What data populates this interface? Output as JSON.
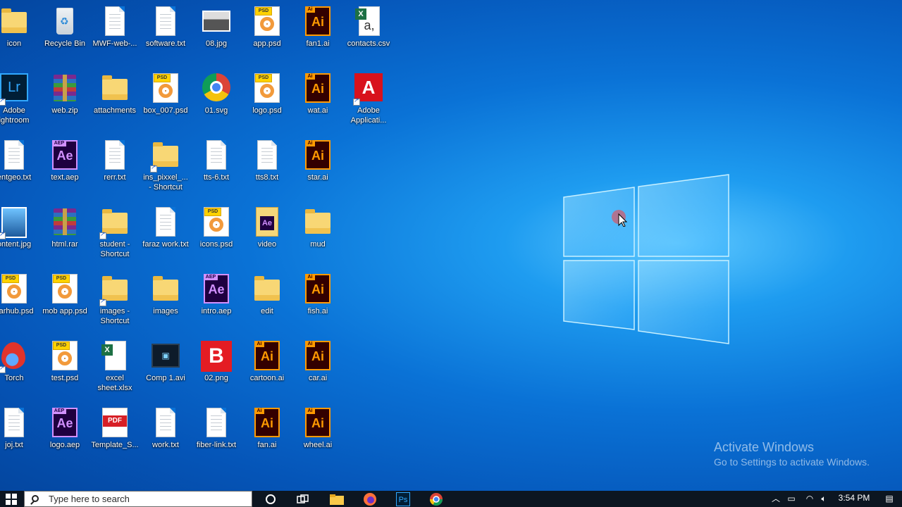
{
  "desktop": {
    "icons": [
      {
        "label": "icon",
        "icon": "folder-icon"
      },
      {
        "label": "Recycle Bin",
        "icon": "recycle-bin-icon"
      },
      {
        "label": "MWF-web-...",
        "icon": "text-file-icon"
      },
      {
        "label": "software.txt",
        "icon": "text-file-icon"
      },
      {
        "label": "08.jpg",
        "icon": "image-file-icon"
      },
      {
        "label": "app.psd",
        "icon": "psd-file-icon"
      },
      {
        "label": "fan1.ai",
        "icon": "illustrator-file-icon"
      },
      {
        "label": "contacts.csv",
        "icon": "csv-file-icon"
      },
      {
        "label": "Adobe\nightroom",
        "icon": "lightroom-icon"
      },
      {
        "label": "web.zip",
        "icon": "rar-archive-icon"
      },
      {
        "label": "attachments",
        "icon": "folder-icon"
      },
      {
        "label": "box_007.psd",
        "icon": "psd-file-icon"
      },
      {
        "label": "01.svg",
        "icon": "chrome-icon"
      },
      {
        "label": "logo.psd",
        "icon": "psd-file-icon"
      },
      {
        "label": "wat.ai",
        "icon": "illustrator-file-icon"
      },
      {
        "label": "Adobe\nApplicati...",
        "icon": "adobe-icon"
      },
      {
        "label": "entgeo.txt",
        "icon": "text-file-icon"
      },
      {
        "label": "text.aep",
        "icon": "after-effects-file-icon"
      },
      {
        "label": "rerr.txt",
        "icon": "text-file-icon"
      },
      {
        "label": "ins_pixxel_...\n- Shortcut",
        "icon": "folder-shortcut-icon"
      },
      {
        "label": "tts-6.txt",
        "icon": "text-file-icon"
      },
      {
        "label": "tts8.txt",
        "icon": "text-file-icon"
      },
      {
        "label": "star.ai",
        "icon": "illustrator-file-icon"
      },
      {
        "label": "ontent.jpg",
        "icon": "image-file-icon"
      },
      {
        "label": "html.rar",
        "icon": "rar-archive-icon"
      },
      {
        "label": "student -\nShortcut",
        "icon": "folder-shortcut-icon"
      },
      {
        "label": "faraz work.txt",
        "icon": "text-file-icon"
      },
      {
        "label": "icons.psd",
        "icon": "psd-file-icon"
      },
      {
        "label": "video",
        "icon": "after-effects-folder-icon"
      },
      {
        "label": "mud",
        "icon": "folder-icon"
      },
      {
        "label": "oarhub.psd",
        "icon": "psd-file-icon"
      },
      {
        "label": "mob app.psd",
        "icon": "psd-file-icon"
      },
      {
        "label": "images -\nShortcut",
        "icon": "folder-shortcut-icon"
      },
      {
        "label": "images",
        "icon": "folder-icon"
      },
      {
        "label": "intro.aep",
        "icon": "after-effects-file-icon"
      },
      {
        "label": "edit",
        "icon": "folder-icon"
      },
      {
        "label": "fish.ai",
        "icon": "illustrator-file-icon"
      },
      {
        "label": "Torch",
        "icon": "torch-browser-icon"
      },
      {
        "label": "test.psd",
        "icon": "psd-file-icon"
      },
      {
        "label": "excel\nsheet.xlsx",
        "icon": "excel-file-icon"
      },
      {
        "label": "Comp 1.avi",
        "icon": "video-file-icon"
      },
      {
        "label": "02.png",
        "icon": "png-file-icon"
      },
      {
        "label": "cartoon.ai",
        "icon": "illustrator-file-icon"
      },
      {
        "label": "car.ai",
        "icon": "illustrator-file-icon"
      },
      {
        "label": "joj.txt",
        "icon": "text-file-icon"
      },
      {
        "label": "logo.aep",
        "icon": "after-effects-file-icon"
      },
      {
        "label": "Template_S...",
        "icon": "pdf-file-icon"
      },
      {
        "label": "work.txt",
        "icon": "text-file-icon"
      },
      {
        "label": "fiber-link.txt",
        "icon": "text-file-icon"
      },
      {
        "label": "fan.ai",
        "icon": "illustrator-file-icon"
      },
      {
        "label": "wheel.ai",
        "icon": "illustrator-file-icon"
      }
    ]
  },
  "icon_glyphs": {
    "lightroom": "Lr",
    "ai": "Ai",
    "ai_tag": "Ai",
    "ae": "Ae",
    "ae_tag": "AEP",
    "psd_tag": "PSD",
    "pdf": "PDF",
    "bred": "B",
    "csv": "a,",
    "adobe": "A"
  },
  "watermark": {
    "line1": "Activate Windows",
    "line2": "Go to Settings to activate Windows."
  },
  "taskbar": {
    "search_placeholder": "Type here to search",
    "clock": "3:54 PM",
    "pinned": [
      "cortana-icon",
      "task-view-icon",
      "file-explorer-icon",
      "firefox-icon",
      "photoshop-icon",
      "chrome-icon"
    ],
    "photoshop_glyph": "Ps"
  },
  "colors": {
    "accent": "#0a72d6",
    "taskbar": "#0c1621"
  }
}
